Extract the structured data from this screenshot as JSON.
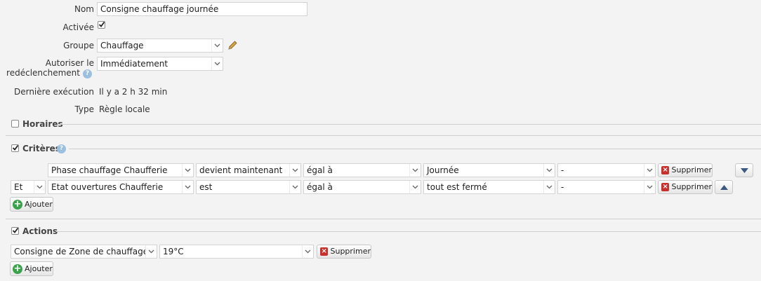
{
  "form": {
    "name_label": "Nom",
    "name_value": "Consigne chauffage journée",
    "enabled_label": "Activée",
    "group_label": "Groupe",
    "group_value": "Chauffage",
    "retrigger_label_1": "Autoriser le",
    "retrigger_label_2": "redéclenchement",
    "retrigger_value": "Immédiatement",
    "last_run_label": "Dernière exécution",
    "last_run_value": "Il y a 2 h 32 min",
    "type_label": "Type",
    "type_value": "Règle locale"
  },
  "sections": {
    "schedules": "Horaires",
    "criteria": "Critères",
    "actions": "Actions"
  },
  "criteria": [
    {
      "connector": "",
      "device": "Phase chauffage Chaufferie",
      "event": "devient maintenant",
      "operator": "égal à",
      "value": "Journée",
      "extra": "-",
      "delete": "Supprimer"
    },
    {
      "connector": "Et",
      "device": "Etat ouvertures Chaufferie",
      "event": "est",
      "operator": "égal à",
      "value": "tout est fermé",
      "extra": "-",
      "delete": "Supprimer"
    }
  ],
  "criteria_add": "Ajouter",
  "action": {
    "target": "Consigne de Zone de chauffage Ch",
    "value": "19°C",
    "delete": "Supprimer"
  },
  "actions_add": "Ajouter",
  "colors": {
    "background": "#f3f3f3",
    "delete_icon": "#c9302c",
    "add_icon": "#39a24a",
    "help_icon": "#9bbfe0"
  }
}
